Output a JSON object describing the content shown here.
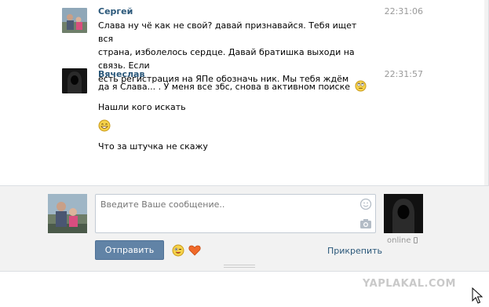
{
  "messages": [
    {
      "author": "Сергей",
      "time": "22:31:06",
      "lines": [
        "Слава ну чё как не свой? давай признавайся. Тебя ищет вся",
        "страна, изболелось сердце. Давай братишка выходи на связь. Если",
        "есть регистрация на ЯПе обозначь ник. Мы тебя ждём"
      ]
    },
    {
      "author": "Вячеслав",
      "time": "22:31:57",
      "lines": [
        "да я Слава... . У меня все збс, снова в активном поиске",
        "Нашли кого искать",
        "",
        "Что за штучка не скажу"
      ]
    }
  ],
  "composer": {
    "placeholder": "Введите Ваше сообщение..",
    "send_label": "Отправить",
    "attach_label": "Прикрепить",
    "peer_status": "online"
  },
  "watermark": "YAPLAKAL.COM",
  "colors": {
    "link": "#2b587a",
    "button": "#6183a6",
    "panel": "#f2f2f2"
  },
  "icons": [
    "smile-icon",
    "camera-icon",
    "wink-emoji-icon",
    "heart-icon",
    "mobile-phone-icon",
    "mouse-cursor-icon"
  ]
}
